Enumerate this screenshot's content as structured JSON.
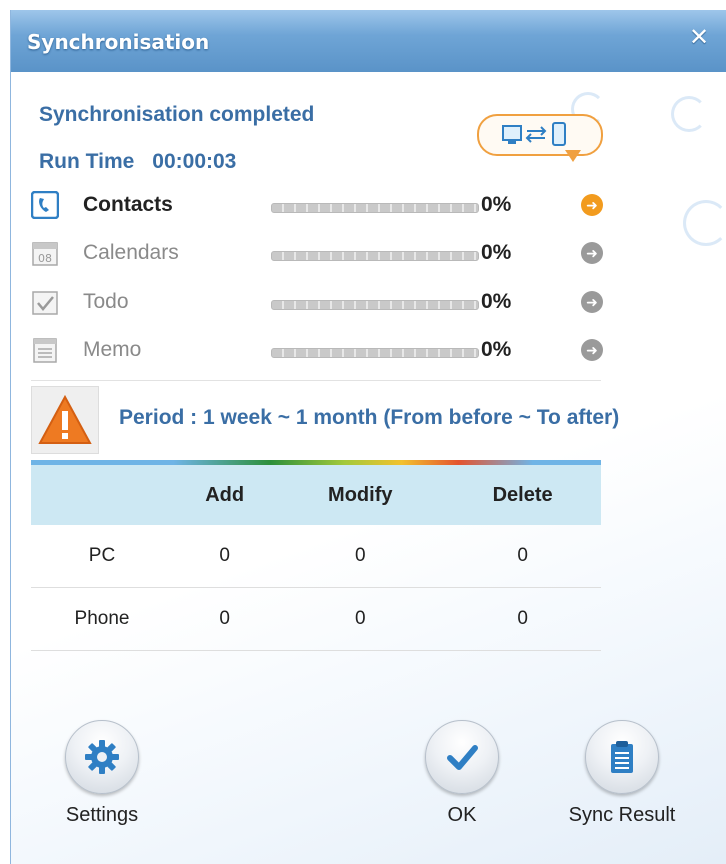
{
  "window": {
    "title": "Synchronisation",
    "close_glyph": "✕"
  },
  "status": {
    "title": "Synchronisation completed",
    "run_time_label": "Run Time",
    "run_time_value": "00:00:03"
  },
  "categories": [
    {
      "label": "Contacts",
      "percent_text": "0%",
      "progress": 0,
      "icon": "contacts-icon",
      "active": true
    },
    {
      "label": "Calendars",
      "percent_text": "0%",
      "progress": 0,
      "icon": "calendar-icon",
      "active": false
    },
    {
      "label": "Todo",
      "percent_text": "0%",
      "progress": 0,
      "icon": "todo-icon",
      "active": false
    },
    {
      "label": "Memo",
      "percent_text": "0%",
      "progress": 0,
      "icon": "memo-icon",
      "active": false
    }
  ],
  "calendar_icon_day": "08",
  "period": {
    "text": "Period : 1 week ~ 1 month (From before ~ To after)"
  },
  "table": {
    "headers": [
      "",
      "Add",
      "Modify",
      "Delete"
    ],
    "rows": [
      {
        "name": "PC",
        "add": "0",
        "modify": "0",
        "delete": "0"
      },
      {
        "name": "Phone",
        "add": "0",
        "modify": "0",
        "delete": "0"
      }
    ]
  },
  "buttons": {
    "settings": "Settings",
    "ok": "OK",
    "sync_result": "Sync Result"
  },
  "colors": {
    "accent_text": "#3a6ea5",
    "active_arrow": "#f29b1e",
    "inactive_arrow": "#9a9a9a",
    "title_bar": "#6fa5d6",
    "table_header": "#cde8f3"
  }
}
